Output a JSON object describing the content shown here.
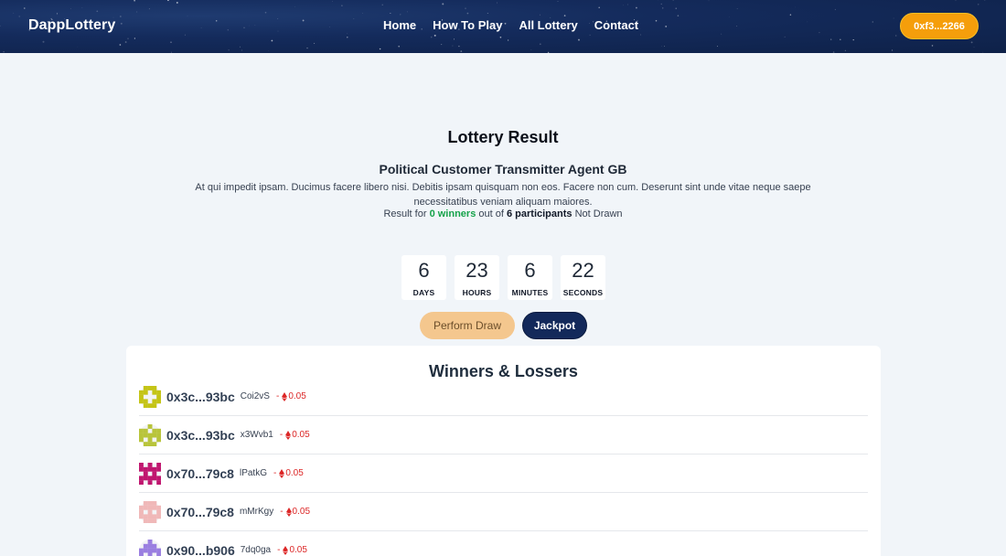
{
  "header": {
    "brand": "DappLottery",
    "nav": [
      {
        "label": "Home"
      },
      {
        "label": "How To Play"
      },
      {
        "label": "All Lottery"
      },
      {
        "label": "Contact"
      }
    ],
    "wallet_label": "0xf3...2266"
  },
  "main": {
    "title": "Lottery Result",
    "lottery_name": "Political Customer Transmitter Agent GB",
    "description": "At qui impedit ipsam. Ducimus facere libero nisi. Debitis ipsam quisquam non eos. Facere non cum. Deserunt sint unde vitae neque saepe necessitatibus veniam aliquam maiores.",
    "result": {
      "prefix": "Result for",
      "winners": "0 winners",
      "middle": "out of",
      "participants": "6 participants",
      "status": "Not Drawn"
    }
  },
  "countdown": [
    {
      "value": "6",
      "label": "DAYS"
    },
    {
      "value": "23",
      "label": "HOURS"
    },
    {
      "value": "6",
      "label": "MINUTES"
    },
    {
      "value": "22",
      "label": "SECONDS"
    }
  ],
  "buttons": {
    "perform_draw": "Perform Draw",
    "jackpot": "Jackpot"
  },
  "winners_card": {
    "title": "Winners & Lossers",
    "rows": [
      {
        "address": "0x3c...93bc",
        "code": "Coi2vS",
        "amount_prefix": "-",
        "amount": "0.05",
        "avatar_color": "#c4c416"
      },
      {
        "address": "0x3c...93bc",
        "code": "x3Wvb1",
        "amount_prefix": "-",
        "amount": "0.05",
        "avatar_color": "#b8c43a"
      },
      {
        "address": "0x70...79c8",
        "code": "lPatkG",
        "amount_prefix": "-",
        "amount": "0.05",
        "avatar_color": "#c0166f"
      },
      {
        "address": "0x70...79c8",
        "code": "mMrKgy",
        "amount_prefix": "-",
        "amount": "0.05",
        "avatar_color": "#f0b8b8"
      },
      {
        "address": "0x90...b906",
        "code": "7dq0ga",
        "amount_prefix": "-",
        "amount": "0.05",
        "avatar_color": "#9a7fe0"
      }
    ]
  },
  "colors": {
    "header_bg": "#142b5c",
    "accent": "#f59e0b",
    "winner_green": "#16a34a",
    "loss_red": "#dc2626",
    "jackpot_bg": "#13295a"
  }
}
